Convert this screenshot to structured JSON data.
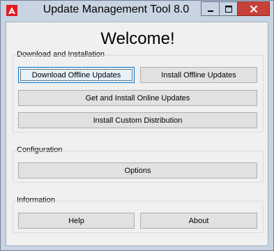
{
  "window": {
    "title": "Update Management Tool 8.0",
    "app_icon": "adobe-logo-icon",
    "controls": [
      "minimize-icon",
      "maximize-icon",
      "close-icon"
    ]
  },
  "welcome": "Welcome!",
  "groups": {
    "download": {
      "label": "Download and Installation",
      "buttons": {
        "download_offline": "Download Offline Updates",
        "install_offline": "Install Offline Updates",
        "get_install_online": "Get and Install Online Updates",
        "install_custom": "Install Custom Distribution"
      }
    },
    "configuration": {
      "label": "Configuration",
      "buttons": {
        "options": "Options"
      }
    },
    "information": {
      "label": "Information",
      "buttons": {
        "help": "Help",
        "about": "About"
      }
    }
  },
  "colors": {
    "title_bar": "#c9d4e3",
    "close_button": "#c7413b",
    "focus_accent": "#0078d7",
    "adobe_red": "#e11c22"
  }
}
